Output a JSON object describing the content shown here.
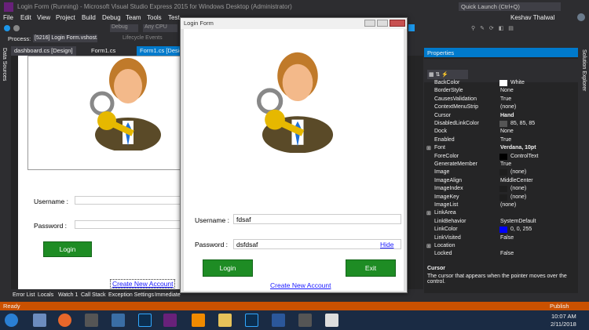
{
  "vs": {
    "title": "Login Form (Running) - Microsoft Visual Studio Express 2015 for Windows Desktop (Administrator)",
    "quick_launch": "Quick Launch (Ctrl+Q)",
    "user": "Keshav Thalwal",
    "menu": [
      "File",
      "Edit",
      "View",
      "Project",
      "Build",
      "Debug",
      "Team",
      "Tools",
      "Test"
    ],
    "toolbar": {
      "config": "Debug",
      "platform": "Any CPU"
    },
    "process_label": "Process:",
    "process_value": "[5216] Login Form.vshost.exe",
    "lifecycle": "Lifecycle Events",
    "doc_tabs": [
      "dashboard.cs [Design]",
      "Form1.cs",
      "Form1.cs [Design]"
    ],
    "left_side_tab": "Data Sources",
    "right_side_tab": "Solution Explorer",
    "tool_tabs": [
      "Error List",
      "Locals",
      "Watch 1",
      "Call Stack",
      "Exception Settings",
      "Immediate"
    ],
    "status": "Ready",
    "publish": "Publish"
  },
  "designer_form": {
    "username_label": "Username :",
    "password_label": "Password :",
    "login_button": "Login",
    "create_link": "Create New Account"
  },
  "login_form": {
    "title": "Login Form",
    "username_label": "Username :",
    "username_value": "fdsaf",
    "password_label": "Password :",
    "password_value": "dsfdsaf",
    "hide_link": "Hide",
    "login_button": "Login",
    "exit_button": "Exit",
    "create_link": "Create New Account"
  },
  "properties": {
    "title": "Properties",
    "rows": [
      {
        "name": "BackColor",
        "value": "White",
        "swatch": "#ffffff"
      },
      {
        "name": "BorderStyle",
        "value": "None"
      },
      {
        "name": "CausesValidation",
        "value": "True"
      },
      {
        "name": "ContextMenuStrip",
        "value": "(none)"
      },
      {
        "name": "Cursor",
        "value": "Hand",
        "bold": true
      },
      {
        "name": "DisabledLinkColor",
        "value": "85, 85, 85",
        "swatch": "#555555"
      },
      {
        "name": "Dock",
        "value": "None"
      },
      {
        "name": "Enabled",
        "value": "True"
      },
      {
        "name": "Font",
        "value": "Verdana, 10pt",
        "bold": true,
        "group": true
      },
      {
        "name": "ForeColor",
        "value": "ControlText",
        "swatch": "#000000"
      },
      {
        "name": "GenerateMember",
        "value": "True"
      },
      {
        "name": "Image",
        "value": "(none)",
        "swatch": "#1e1e1e"
      },
      {
        "name": "ImageAlign",
        "value": "MiddleCenter"
      },
      {
        "name": "ImageIndex",
        "value": "(none)",
        "swatch": "#1e1e1e"
      },
      {
        "name": "ImageKey",
        "value": "(none)",
        "swatch": "#1e1e1e"
      },
      {
        "name": "ImageList",
        "value": "(none)"
      },
      {
        "name": "LinkArea",
        "value": "",
        "group": true
      },
      {
        "name": "LinkBehavior",
        "value": "SystemDefault"
      },
      {
        "name": "LinkColor",
        "value": "0, 0, 255",
        "swatch": "#0000ff"
      },
      {
        "name": "LinkVisited",
        "value": "False"
      },
      {
        "name": "Location",
        "value": "",
        "group": true
      },
      {
        "name": "Locked",
        "value": "False"
      }
    ],
    "desc_title": "Cursor",
    "desc_text": "The cursor that appears when the pointer moves over the control."
  },
  "clock": {
    "time": "10:07 AM",
    "date": "2/11/2018"
  },
  "colors": {
    "accent": "#ca5100",
    "taskbar": "#1a2b44",
    "green": "#1e8c24"
  }
}
